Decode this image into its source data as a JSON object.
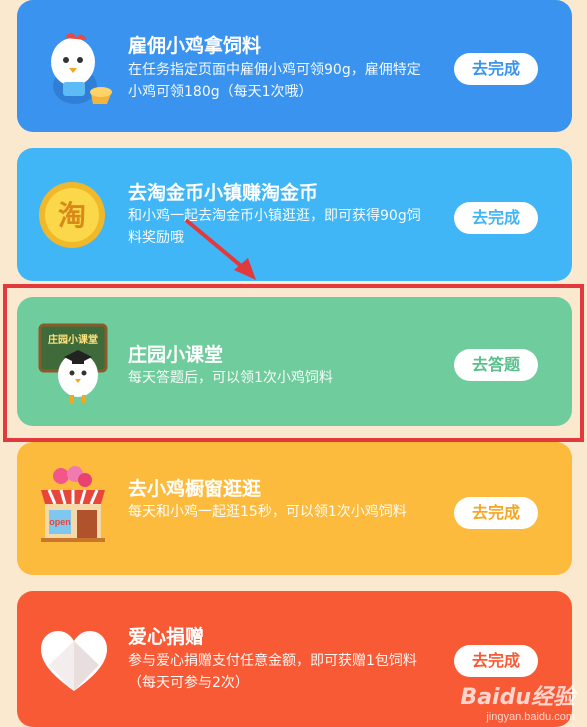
{
  "tasks": [
    {
      "title": "雇佣小鸡拿饲料",
      "description": "在任务指定页面中雇佣小鸡可领90g，雇佣特定小鸡可领180g（每天1次哦）",
      "button": "去完成",
      "button_color": "#3a94ef",
      "icon": "chicken-employee-icon"
    },
    {
      "title": "去淘金币小镇赚淘金币",
      "description": "和小鸡一起去淘金币小镇逛逛，即可获得90g饲料奖励哦",
      "button": "去完成",
      "button_color": "#40b6f6",
      "icon": "taojinbi-coin-icon",
      "coin_char": "淘"
    },
    {
      "title": "庄园小课堂",
      "description": "每天答题后，可以领1次小鸡饲料",
      "button": "去答题",
      "button_color": "#5bbf8b",
      "icon": "farm-classroom-icon",
      "board_text": "庄园小课堂"
    },
    {
      "title": "去小鸡橱窗逛逛",
      "description": "每天和小鸡一起逛15秒，可以领1次小鸡饲料",
      "button": "去完成",
      "button_color": "#f6a623",
      "icon": "shop-window-icon",
      "sign_text": "open"
    },
    {
      "title": "爱心捐赠",
      "description": "参与爱心捐赠支付任意金额，即可获赠1包饲料（每天可参与2次）",
      "button": "去完成",
      "button_color": "#f95a36",
      "icon": "heart-icon"
    }
  ],
  "watermark": {
    "logo": "Baidu经验",
    "url": "jingyan.baidu.com"
  }
}
